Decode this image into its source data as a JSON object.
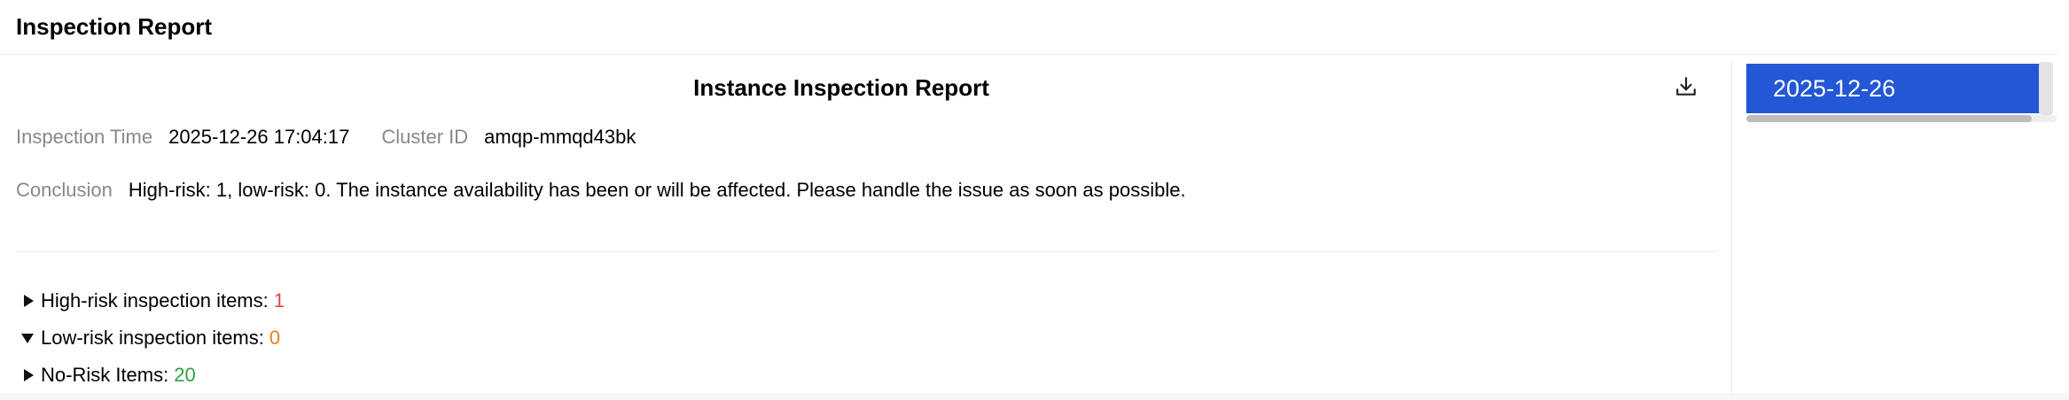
{
  "header": {
    "title": "Inspection Report"
  },
  "report": {
    "title": "Instance Inspection Report",
    "inspection_time_label": "Inspection Time",
    "inspection_time_value": "2025-12-26 17:04:17",
    "cluster_id_label": "Cluster ID",
    "cluster_id_value": "amqp-mmqd43bk",
    "conclusion_label": "Conclusion",
    "conclusion_value": "High-risk: 1, low-risk: 0. The instance availability has been or will be affected. Please handle the issue as soon as possible.",
    "download_icon": "download-icon"
  },
  "sections": [
    {
      "label": "High-risk inspection items:",
      "count": "1",
      "expanded": false,
      "color": "#e54545"
    },
    {
      "label": "Low-risk inspection items:",
      "count": "0",
      "expanded": true,
      "color": "#e8801a"
    },
    {
      "label": "No-Risk Items:",
      "count": "20",
      "expanded": false,
      "color": "#2ba245"
    }
  ],
  "sidebar": {
    "dates": [
      "2025-12-26"
    ],
    "selected_color": "#2457d6"
  }
}
